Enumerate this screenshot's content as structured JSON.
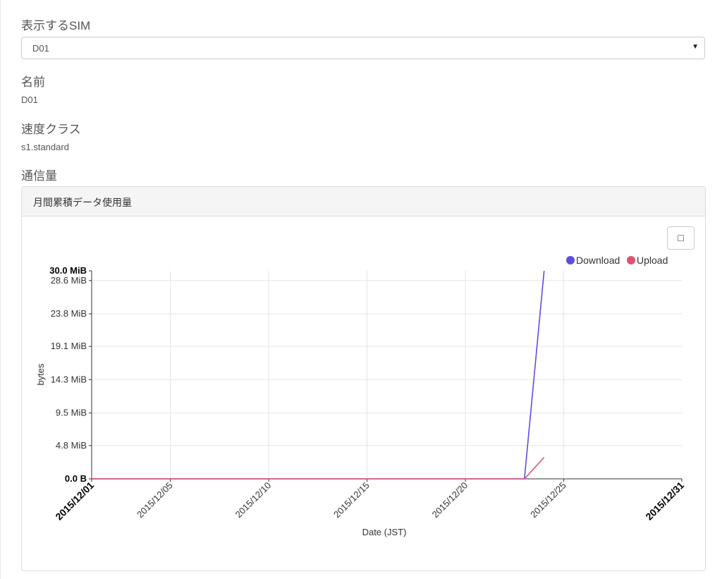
{
  "sim_select": {
    "label": "表示するSIM",
    "selected": "D01",
    "caret": "▼"
  },
  "name": {
    "label": "名前",
    "value": "D01"
  },
  "speed_class": {
    "label": "速度クラス",
    "value": "s1.standard"
  },
  "traffic": {
    "label": "通信量"
  },
  "panel": {
    "title": "月間累積データ使用量",
    "toggle_button": "□"
  },
  "chart_data": {
    "type": "line",
    "xlabel": "Date (JST)",
    "ylabel": "bytes",
    "x_domain": [
      "2015/12/01",
      "2015/12/31"
    ],
    "x_ticks": [
      {
        "date": "2015/12/01",
        "bold": true
      },
      {
        "date": "2015/12/05",
        "bold": false
      },
      {
        "date": "2015/12/10",
        "bold": false
      },
      {
        "date": "2015/12/15",
        "bold": false
      },
      {
        "date": "2015/12/20",
        "bold": false
      },
      {
        "date": "2015/12/25",
        "bold": false
      },
      {
        "date": "2015/12/31",
        "bold": true
      }
    ],
    "ylim": [
      0,
      30.0
    ],
    "y_unit": "MiB",
    "y_ticks": [
      {
        "value": 0,
        "label": "0.0 B",
        "bold": true
      },
      {
        "value": 4.8,
        "label": "4.8 MiB",
        "bold": false
      },
      {
        "value": 9.5,
        "label": "9.5 MiB",
        "bold": false
      },
      {
        "value": 14.3,
        "label": "14.3 MiB",
        "bold": false
      },
      {
        "value": 19.1,
        "label": "19.1 MiB",
        "bold": false
      },
      {
        "value": 23.8,
        "label": "23.8 MiB",
        "bold": false
      },
      {
        "value": 28.6,
        "label": "28.6 MiB",
        "bold": false
      },
      {
        "value": 30.0,
        "label": "30.0 MiB",
        "bold": true
      }
    ],
    "grid": true,
    "legend_position": "top-right",
    "series": [
      {
        "name": "Download",
        "color": "#5b4fe0",
        "points": [
          {
            "x": "2015/12/01",
            "y": 0
          },
          {
            "x": "2015/12/23",
            "y": 0
          },
          {
            "x": "2015/12/24",
            "y": 30.0
          }
        ]
      },
      {
        "name": "Upload",
        "color": "#e05272",
        "points": [
          {
            "x": "2015/12/01",
            "y": 0
          },
          {
            "x": "2015/12/23",
            "y": 0
          },
          {
            "x": "2015/12/24",
            "y": 3.1
          }
        ]
      }
    ]
  }
}
